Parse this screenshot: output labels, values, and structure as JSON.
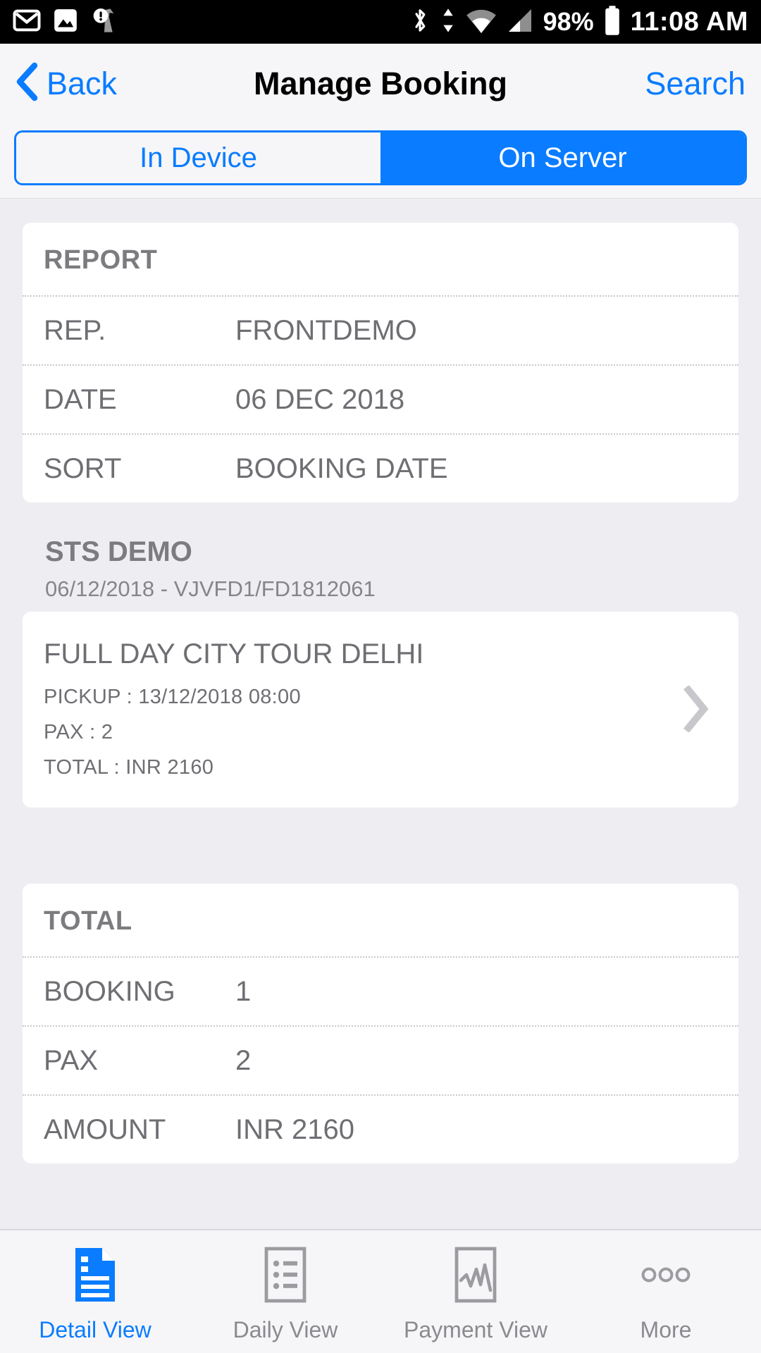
{
  "status_bar": {
    "time": "11:08 AM",
    "battery_percent": "98%",
    "left_icons": [
      "gmail-icon",
      "photos-icon",
      "alert-app-icon"
    ],
    "right_icons": [
      "bluetooth-icon",
      "data-transfer-icon",
      "wifi-icon",
      "cellular-signal-icon",
      "battery-icon"
    ]
  },
  "navbar": {
    "back_label": "Back",
    "title": "Manage Booking",
    "search_label": "Search"
  },
  "segmented": {
    "options": [
      {
        "label": "In Device",
        "active": false
      },
      {
        "label": "On Server",
        "active": true
      }
    ]
  },
  "report_card": {
    "title": "REPORT",
    "rows": [
      {
        "label": "REP.",
        "value": "FRONTDEMO"
      },
      {
        "label": "DATE",
        "value": "06 DEC 2018"
      },
      {
        "label": "SORT",
        "value": "BOOKING DATE"
      }
    ]
  },
  "group": {
    "title": "STS DEMO",
    "subtitle": "06/12/2018 - VJVFD1/FD1812061"
  },
  "booking": {
    "title": "FULL DAY CITY TOUR DELHI",
    "pickup": "PICKUP : 13/12/2018 08:00",
    "pax": "PAX : 2",
    "total": "TOTAL : INR 2160",
    "chevron": "chevron-right-icon"
  },
  "total_card": {
    "title": "TOTAL",
    "rows": [
      {
        "label": "BOOKING",
        "value": "1"
      },
      {
        "label": "PAX",
        "value": "2"
      },
      {
        "label": "AMOUNT",
        "value": "INR 2160"
      }
    ]
  },
  "tabbar": {
    "items": [
      {
        "label": "Detail View",
        "icon": "document-icon",
        "active": true
      },
      {
        "label": "Daily View",
        "icon": "list-icon",
        "active": false
      },
      {
        "label": "Payment View",
        "icon": "chart-icon",
        "active": false
      },
      {
        "label": "More",
        "icon": "ellipsis-icon",
        "active": false
      }
    ]
  },
  "colors": {
    "accent": "#0a7cff",
    "page_bg": "#eeeef2",
    "card_bg": "#ffffff",
    "text_muted": "#6e6e73",
    "chevron": "#c8c8cc"
  }
}
